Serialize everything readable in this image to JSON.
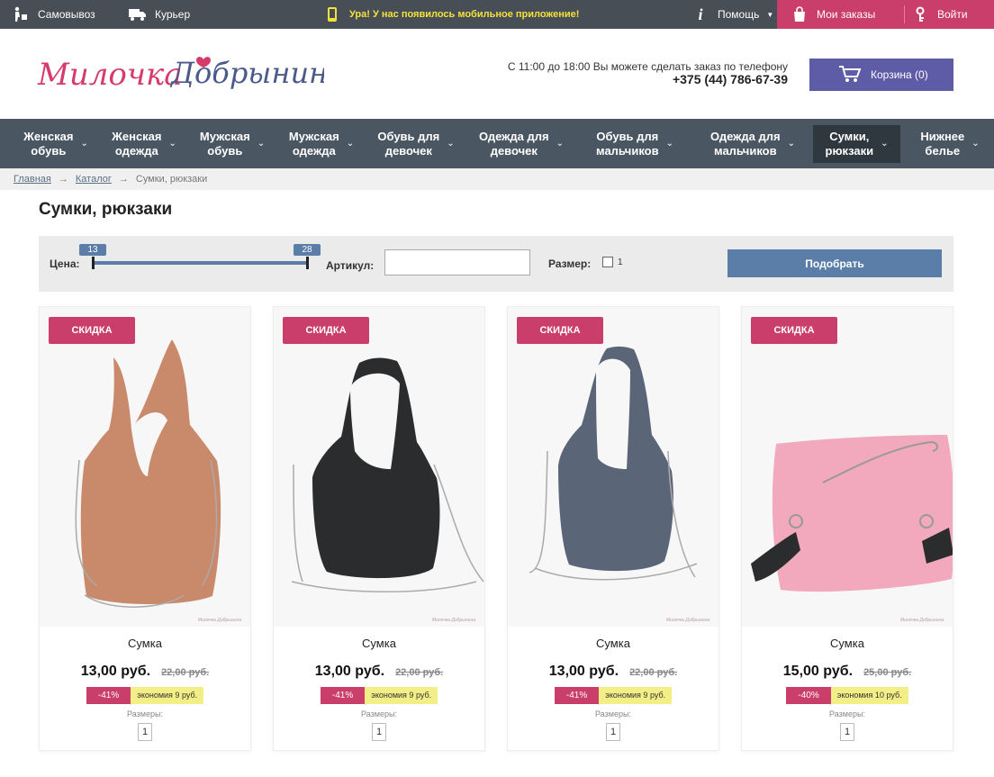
{
  "topbar": {
    "pickup": "Самовывоз",
    "courier": "Курьер",
    "promo": "Ура! У нас появилось мобильное приложение!",
    "help": "Помощь",
    "my_orders": "Мои заказы",
    "login": "Войти"
  },
  "header": {
    "logo_text": "Милочка Добрынина",
    "phone_note": "С 11:00 до 18:00 Вы можете сделать заказ по телефону",
    "phone": "+375 (44) 786-67-39",
    "cart": "Корзина (0)"
  },
  "nav": [
    {
      "label": "Женская\nобувь"
    },
    {
      "label": "Женская\nодежда"
    },
    {
      "label": "Мужская\nобувь"
    },
    {
      "label": "Мужская\nодежда"
    },
    {
      "label": "Обувь для\nдевочек"
    },
    {
      "label": "Одежда для\nдевочек"
    },
    {
      "label": "Обувь для\nмальчиков"
    },
    {
      "label": "Одежда для\nмальчиков"
    },
    {
      "label": "Сумки,\nрюкзаки",
      "active": true
    },
    {
      "label": "Нижнее\nбелье"
    }
  ],
  "breadcrumb": {
    "home": "Главная",
    "sep": "→",
    "catalog": "Каталог",
    "current": "Сумки, рюкзаки"
  },
  "page_title": "Сумки, рюкзаки",
  "filter": {
    "price_label": "Цена:",
    "price_min": "13",
    "price_max": "28",
    "article_label": "Артикул:",
    "article_value": "",
    "size_label": "Размер:",
    "size_option": "1",
    "submit": "Подобрать"
  },
  "products": [
    {
      "badge": "СКИДКА",
      "name": "Сумка",
      "price": "13,00 руб.",
      "old_price": "22,00 руб.",
      "discount": "-41%",
      "saving": "экономия 9 руб.",
      "sizes_label": "Размеры:",
      "size": "1",
      "color": "#c98a6c"
    },
    {
      "badge": "СКИДКА",
      "name": "Сумка",
      "price": "13,00 руб.",
      "old_price": "22,00 руб.",
      "discount": "-41%",
      "saving": "экономия 9 руб.",
      "sizes_label": "Размеры:",
      "size": "1",
      "color": "#2b2c2e"
    },
    {
      "badge": "СКИДКА",
      "name": "Сумка",
      "price": "13,00 руб.",
      "old_price": "22,00 руб.",
      "discount": "-41%",
      "saving": "экономия 9 руб.",
      "sizes_label": "Размеры:",
      "size": "1",
      "color": "#5a6577"
    },
    {
      "badge": "СКИДКА",
      "name": "Сумка",
      "price": "15,00 руб.",
      "old_price": "25,00 руб.",
      "discount": "-40%",
      "saving": "экономия 10 руб.",
      "sizes_label": "Размеры:",
      "size": "1",
      "color": "#f2a8bd"
    }
  ],
  "colors": {
    "topbar": "#474e56",
    "accent_pink": "#c93e6b",
    "nav": "#4a5661",
    "cart_button": "#5e5ba7",
    "filter_button": "#5b7ea8",
    "promo_yellow": "#f3e23a"
  }
}
